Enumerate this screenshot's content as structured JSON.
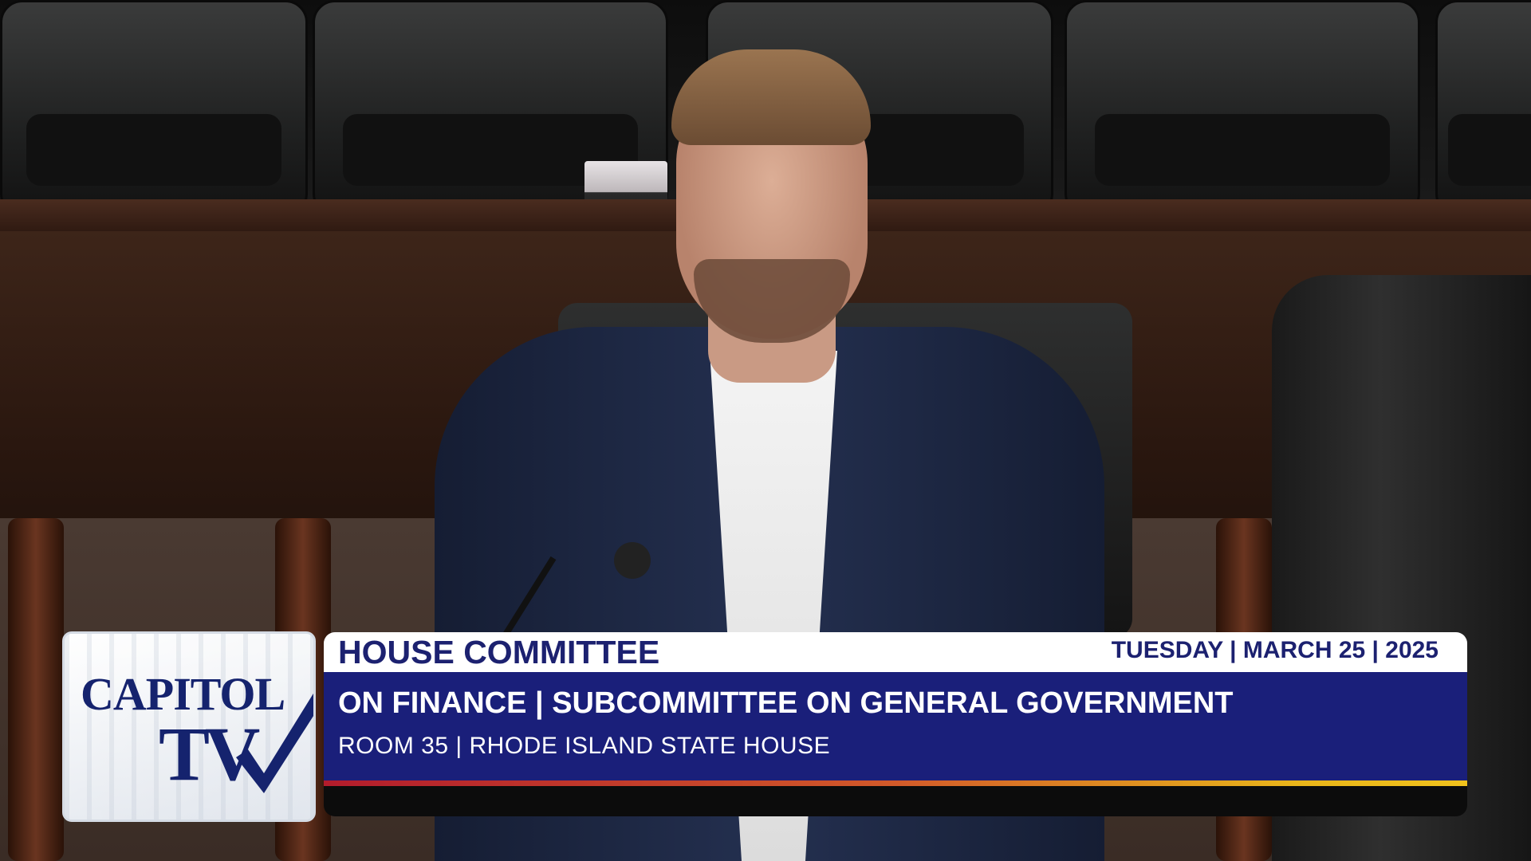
{
  "lower_third": {
    "title": "HOUSE COMMITTEE",
    "date": "TUESDAY | MARCH 25 | 2025",
    "subtitle": "ON FINANCE | SUBCOMMITTEE ON GENERAL GOVERNMENT",
    "location": "ROOM 35 | RHODE ISLAND STATE HOUSE"
  },
  "logo": {
    "line1": "CAPITOL",
    "line2": "TV",
    "icon": "checkmark-icon"
  },
  "colors": {
    "navy": "#1a1f7a",
    "title_text": "#1c2170",
    "stripe_red": "#b21c2c",
    "stripe_gold": "#f0c21c"
  }
}
